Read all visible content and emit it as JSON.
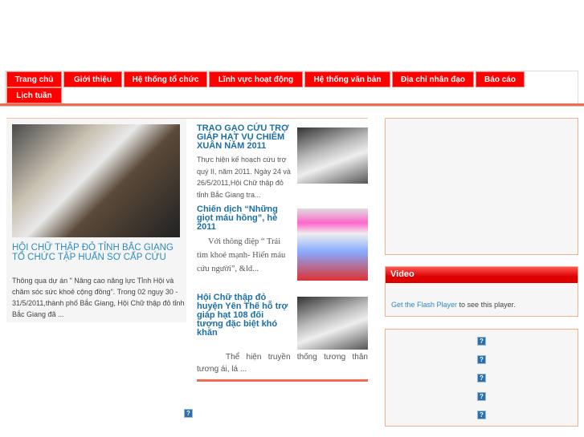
{
  "nav": [
    "Trang chủ",
    "Giới thiệu",
    "Hệ thống tổ chức",
    "Lĩnh vực hoạt động",
    "Hệ thống văn bản",
    "Địa chỉ nhân đạo",
    "Báo cáo",
    "Lịch tuần"
  ],
  "featured": {
    "title": "HỘI CHỮ THẬP ĐỎ TỈNH BẮC GIANG TỔ CHỨC TẬP HUẤN SƠ CẤP CỨU",
    "summary": " Thông qua dự án \" Nâng cao năng lực Tỉnh Hội và chăm sóc sức khoẻ cộng đồng\". Trong 02 ngụy 30 - 31/5/2011,thành phố Bắc Giang, Hội Chữ thập đỏ tỉnh Bắc Giang đã ..."
  },
  "news": [
    {
      "title": "TRAO GẠO CỨU TRỢ GIÁP HẠT VỤ CHIÊM XUÂN NĂM 2011",
      "summary": "Thực hiện kế hoạch cứu trợ quý II, năm 2011. Ngày 24 và 26/5/2011,Hội Chữ thập đỏ tỉnh Bắc Giang tra..."
    },
    {
      "title": "Chiến dịch “Những giọt máu hồng”, hè 2011",
      "summary": "Với thông điệp “ Trái tim khoẻ mạnh- Hiến máu cứu người”, &ld..."
    },
    {
      "title": "Hội Chữ thập đỏ huyện Yên Thế hỗ trợ giáp hạt 108 đối tượng đặc biệt khó khăn",
      "summary": "Thể hiện truyền thống tương thân tương ái, lá ..."
    }
  ],
  "video": {
    "header": "Video",
    "link": "Get the Flash Player",
    "text": " to see this player."
  },
  "icon_glyph": "?",
  "colors": {
    "nav": "#ff0000",
    "accent": "#f36a50",
    "link": "#2e8bc0"
  }
}
